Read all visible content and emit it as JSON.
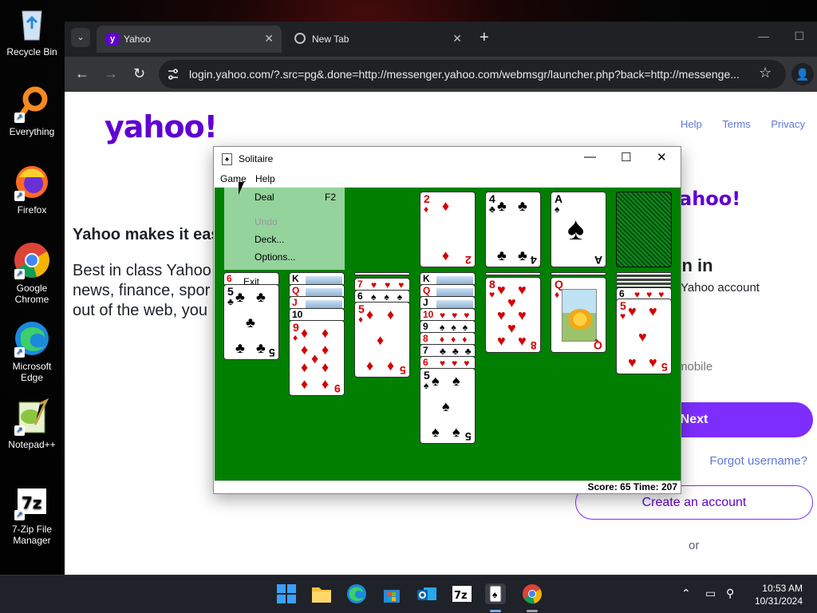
{
  "desktop": {
    "icons": [
      {
        "label": "Recycle Bin"
      },
      {
        "label": "Everything"
      },
      {
        "label": "Firefox"
      },
      {
        "label": "Google Chrome"
      },
      {
        "label": "Microsoft Edge"
      },
      {
        "label": "Notepad++"
      },
      {
        "label": "7-Zip File Manager"
      }
    ]
  },
  "browser": {
    "tabs": [
      {
        "title": "Yahoo",
        "active": true
      },
      {
        "title": "New Tab",
        "active": false
      }
    ],
    "url": "login.yahoo.com/?.src=pg&.done=http://messenger.yahoo.com/webmsgr/launcher.php?back=http://messenge...",
    "page": {
      "logo": "yahoo!",
      "links": [
        "Help",
        "Terms",
        "Privacy"
      ],
      "hero_title": "Yahoo makes it eas",
      "hero_lines": [
        "Best in class Yahoo",
        "news, finance, spor",
        "out of the web, you"
      ],
      "signin": {
        "logo": "ahoo!",
        "heading": "gn in",
        "subheading": "Yahoo account",
        "input_placeholder": "mobile",
        "next_label": "Next",
        "forgot_label": "Forgot username?",
        "create_label": "Create an account",
        "or_label": "or"
      }
    }
  },
  "solitaire": {
    "title": "Solitaire",
    "menus": [
      "Game",
      "Help"
    ],
    "game_menu": {
      "items": [
        {
          "label": "Deal",
          "shortcut": "F2",
          "enabled": true
        },
        {
          "label": "Undo",
          "enabled": false
        },
        {
          "label": "Deck...",
          "enabled": true
        },
        {
          "label": "Options...",
          "enabled": true
        },
        {
          "label": "Exit",
          "enabled": true
        }
      ]
    },
    "foundations": [
      {
        "rank": "2",
        "suit": "♦"
      },
      {
        "rank": "4",
        "suit": "♣"
      },
      {
        "rank": "A",
        "suit": "♠"
      }
    ],
    "tableau": [
      {
        "stack": [
          "6"
        ],
        "top": {
          "rank": "5",
          "suit": "♣"
        }
      },
      {
        "stack": [
          "K",
          "Q",
          "J",
          "10"
        ],
        "top": {
          "rank": "9",
          "suit": "♦"
        }
      },
      {
        "stack": [
          "7",
          "6"
        ],
        "top": {
          "rank": "5",
          "suit": "♦"
        }
      },
      {
        "stack": [
          "K",
          "Q",
          "J",
          "10",
          "9",
          "8",
          "7",
          "6"
        ],
        "top": {
          "rank": "5",
          "suit": "♠"
        }
      },
      {
        "stack": [],
        "top": {
          "rank": "8",
          "suit": "♥"
        }
      },
      {
        "stack": [],
        "top": {
          "rank": "Q",
          "suit": "♦"
        }
      },
      {
        "stack": [
          "6"
        ],
        "top": {
          "rank": "5",
          "suit": "♥"
        }
      }
    ],
    "status": "Score: 65 Time: 207"
  },
  "taskbar": {
    "time": "10:53 AM",
    "date": "10/31/2024"
  }
}
